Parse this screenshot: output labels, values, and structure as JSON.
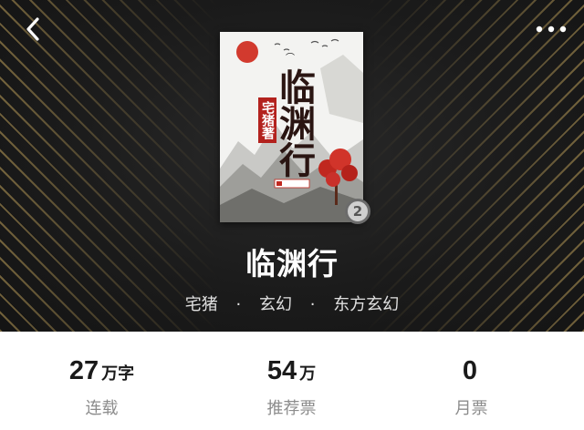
{
  "header": {
    "back_icon": "chevron-left-icon",
    "more_icon": "more-dots-icon"
  },
  "book": {
    "title": "临渊行",
    "cover": {
      "title_text": "临渊行",
      "author_text": "宅猪著",
      "accent_color": "#b3221e"
    },
    "rank_badge": "2",
    "author": "宅猪",
    "separator": "·",
    "category": "玄幻",
    "subcategory": "东方玄幻"
  },
  "stats": [
    {
      "value": "27",
      "unit": "万字",
      "label": "连载"
    },
    {
      "value": "54",
      "unit": "万",
      "label": "推荐票"
    },
    {
      "value": "0",
      "unit": "",
      "label": "月票"
    }
  ]
}
